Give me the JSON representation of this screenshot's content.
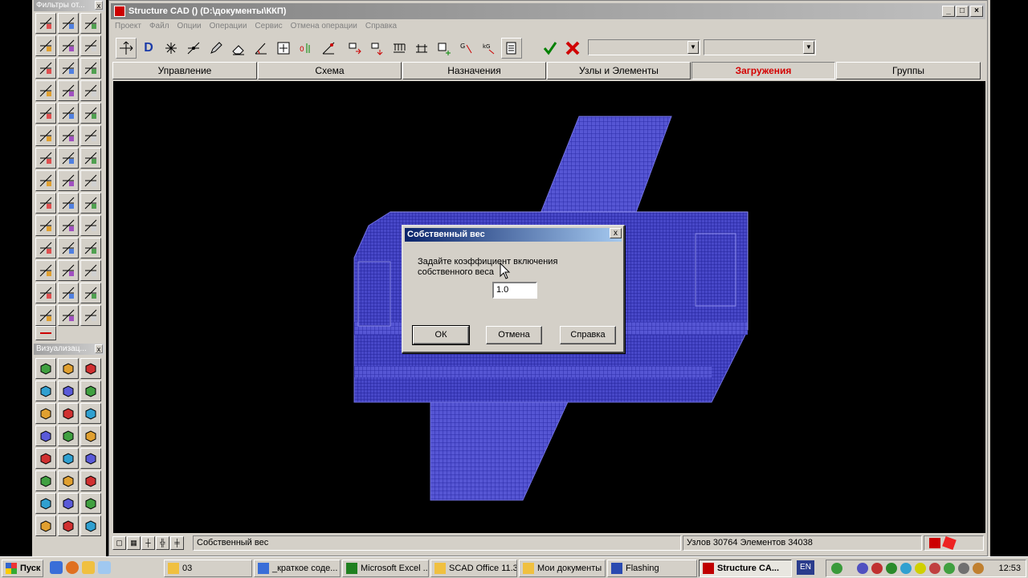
{
  "palettes": {
    "filters": {
      "title": "Фильтры от..."
    },
    "visualization": {
      "title": "Визуализац..."
    },
    "close_glyph": "x"
  },
  "window": {
    "title": "Structure CAD () (D:\\документы\\ККП)",
    "min_glyph": "_",
    "max_glyph": "□",
    "close_glyph": "×"
  },
  "menu": [
    "Проект",
    "Файл",
    "Опции",
    "Операции",
    "Сервис",
    "Отмена операции",
    "Справка"
  ],
  "toolbar": {
    "combo1_value": "",
    "combo2_value": "",
    "d_label": "D",
    "ok_icon": "check-icon",
    "cancel_icon": "red-x-icon"
  },
  "tabs": [
    "Управление",
    "Схема",
    "Назначения",
    "Узлы и Элементы",
    "Загружения",
    "Группы"
  ],
  "active_tab": "Загружения",
  "status": {
    "operation": "Собственный вес",
    "counts": "Узлов 30764 Элементов 34038"
  },
  "dialog": {
    "title": "Собственный вес",
    "close_glyph": "x",
    "prompt_line1": "Задайте коэффициент включения",
    "prompt_line2": "собственного веса",
    "value": "1.0",
    "ok_label": "ОК",
    "cancel_label": "Отмена",
    "help_label": "Справка"
  },
  "taskbar": {
    "start_label": "Пуск",
    "tasks": [
      "03",
      "_краткое соде...",
      "Microsoft Excel ...",
      "SCAD Office 11.3",
      "Мои документы",
      "Flashing",
      "Structure CA..."
    ],
    "language": "EN",
    "clock": "12:53"
  },
  "colors": {
    "mesh": "#5a5ad8",
    "mesh_line": "#3030b0",
    "accent_active_tab": "#d40000"
  }
}
